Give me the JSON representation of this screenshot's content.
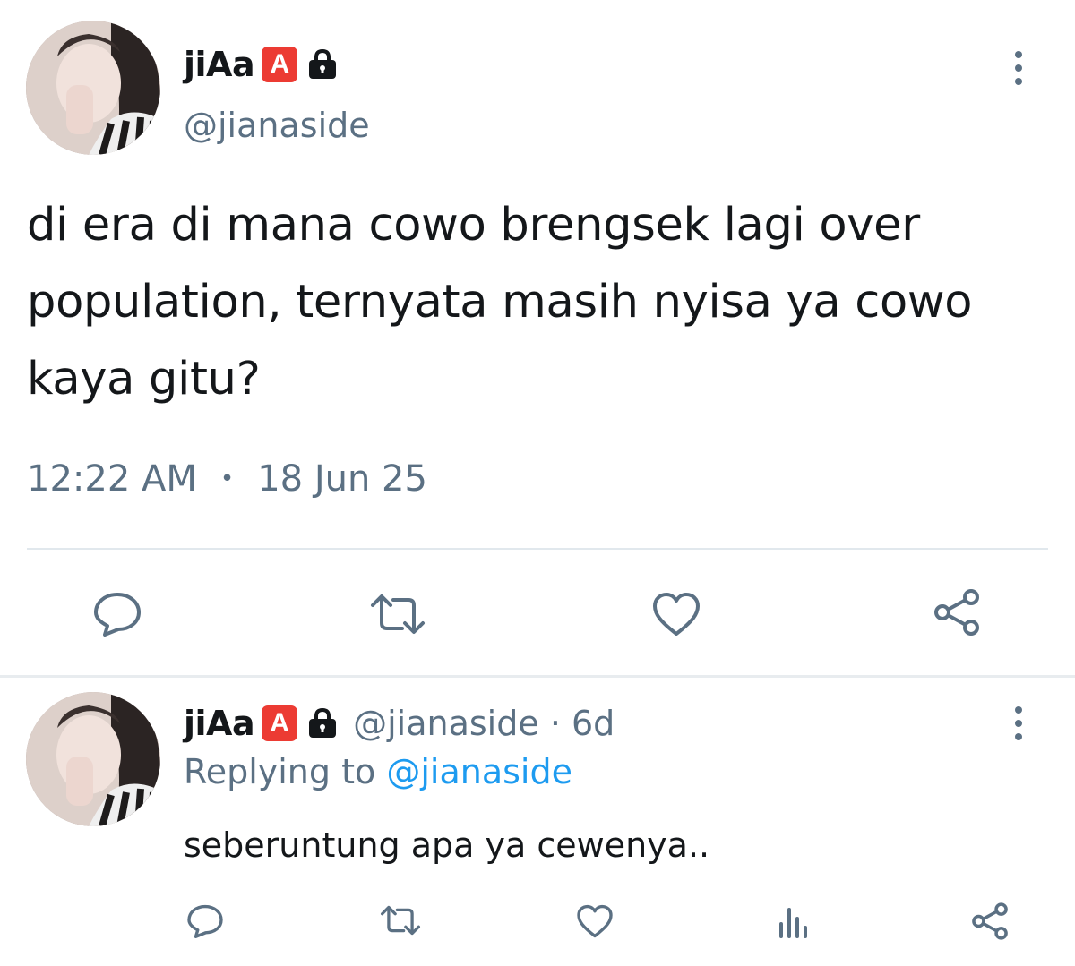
{
  "main_tweet": {
    "display_name": "jiAa",
    "badge_letter": "A",
    "handle": "@jianaside",
    "text_lines": [
      "di era di mana cowo brengsek lagi over",
      "population, ternyata masih nyisa ya cowo",
      "kaya gitu?"
    ],
    "time": "12:22 AM",
    "separator": "•",
    "date": "18 Jun 25",
    "actions": [
      "reply-icon",
      "retweet-icon",
      "like-icon",
      "share-icon"
    ]
  },
  "reply_tweet": {
    "display_name": "jiAa",
    "badge_letter": "A",
    "handle_age": "@jianaside · 6d",
    "replying_prefix": "Replying to",
    "replying_handle": "@jianaside",
    "text": "seberuntung apa ya cewenya..",
    "actions": [
      "reply-icon",
      "retweet-icon",
      "like-icon",
      "analytics-icon",
      "share-icon"
    ]
  },
  "colors": {
    "text": "#14171a",
    "secondary": "#5b7083",
    "link": "#1d9bf0",
    "badge": "#ec3b33"
  }
}
